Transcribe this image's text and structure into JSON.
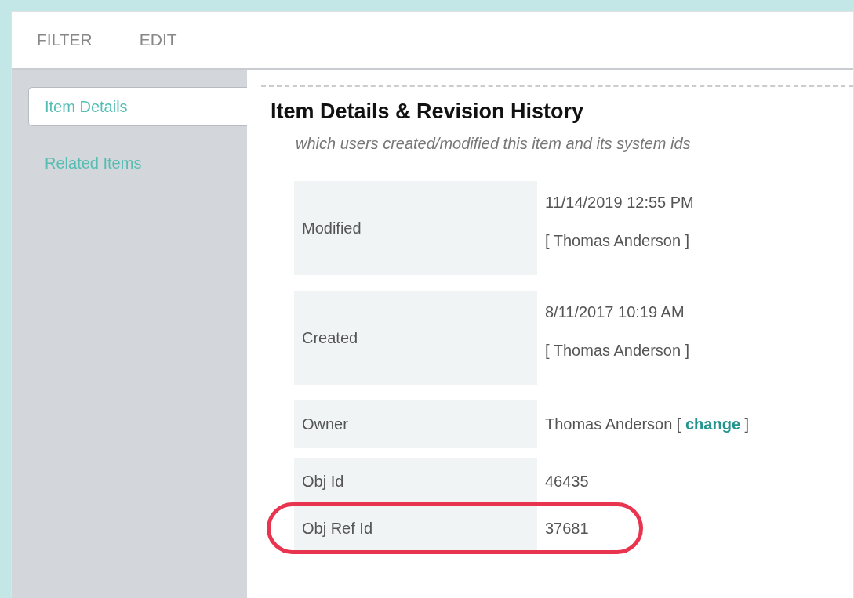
{
  "toolbar": {
    "items": [
      {
        "label": "FILTER"
      },
      {
        "label": "EDIT"
      }
    ]
  },
  "sidebar": {
    "items": [
      {
        "label": "Item Details",
        "selected": true
      },
      {
        "label": "Related Items",
        "selected": false
      }
    ]
  },
  "section": {
    "title": "Item Details & Revision History",
    "subtitle": "which users created/modified this item and its system ids"
  },
  "details": [
    {
      "label": "Modified",
      "kind": "stamp",
      "lines": [
        "11/14/2019 12:55 PM",
        "[ Thomas Anderson ]"
      ],
      "highlighted": false
    },
    {
      "label": "Created",
      "kind": "stamp",
      "lines": [
        "8/11/2017 10:19 AM",
        "[ Thomas Anderson ]"
      ],
      "highlighted": false
    },
    {
      "label": "Owner",
      "kind": "owner",
      "value": "Thomas Anderson [ ",
      "link": "change",
      "value_end": " ]",
      "highlighted": false
    },
    {
      "label": "Obj Id",
      "kind": "plain",
      "value": "46435",
      "highlighted": false
    },
    {
      "label": "Obj Ref Id",
      "kind": "plain",
      "value": "37681",
      "highlighted": true
    }
  ]
}
